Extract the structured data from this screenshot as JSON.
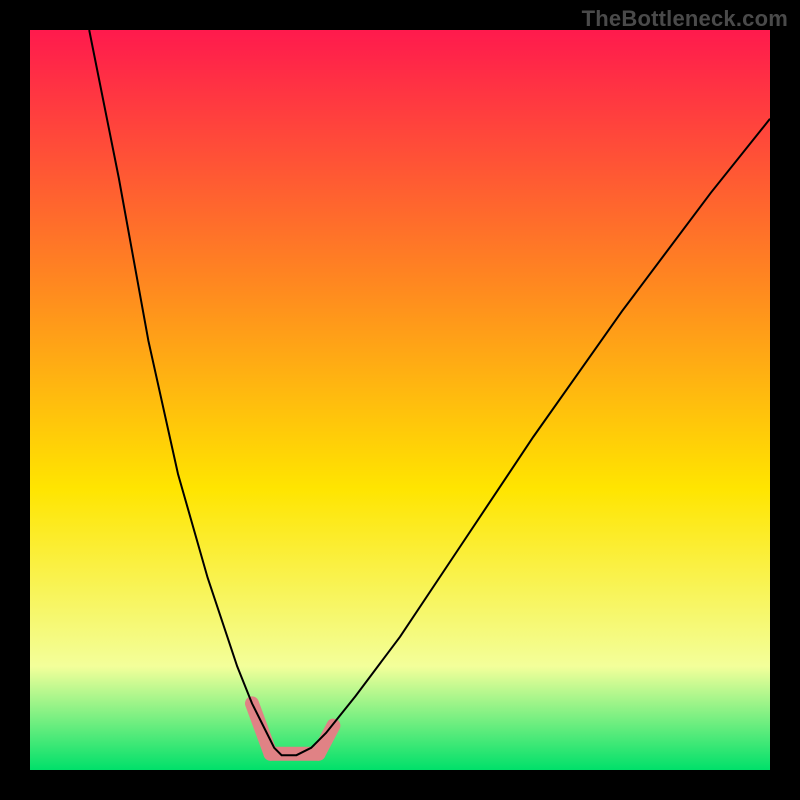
{
  "watermark": "TheBottleneck.com",
  "chart_data": {
    "type": "line",
    "title": "",
    "xlabel": "",
    "ylabel": "",
    "xlim": [
      0,
      100
    ],
    "ylim": [
      0,
      100
    ],
    "grid": false,
    "background_gradient": {
      "top": "#ff1a4d",
      "mid1": "#ff8a1f",
      "mid2": "#ffe500",
      "mid3": "#f3ff9a",
      "bottom": "#00e06a"
    },
    "series": [
      {
        "name": "bottleneck-curve",
        "x": [
          8,
          12,
          16,
          20,
          24,
          28,
          30,
          32,
          33,
          34,
          35,
          36,
          38,
          40,
          44,
          50,
          58,
          68,
          80,
          92,
          100
        ],
        "y": [
          100,
          80,
          58,
          40,
          26,
          14,
          9,
          5,
          3,
          2,
          2,
          2,
          3,
          5,
          10,
          18,
          30,
          45,
          62,
          78,
          88
        ],
        "color": "#000000",
        "linewidth": 2
      }
    ],
    "annotations": [
      {
        "name": "optimal-marker-left",
        "type": "thick-segment",
        "x": [
          30,
          32.5
        ],
        "y": [
          9,
          2.2
        ],
        "color": "#e08285",
        "linewidth": 14
      },
      {
        "name": "optimal-marker-bottom",
        "type": "thick-segment",
        "x": [
          32.5,
          39
        ],
        "y": [
          2.2,
          2.2
        ],
        "color": "#e08285",
        "linewidth": 14
      },
      {
        "name": "optimal-marker-right",
        "type": "thick-segment",
        "x": [
          39,
          41
        ],
        "y": [
          2.2,
          6
        ],
        "color": "#e08285",
        "linewidth": 14
      }
    ]
  }
}
